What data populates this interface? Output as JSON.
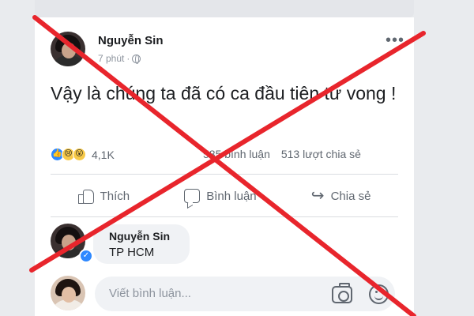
{
  "post": {
    "author": "Nguyễn Sin",
    "time": "7 phút",
    "separator": "·",
    "more": "•••",
    "text": "Vậy là chúng ta đã có ca đầu tiên tử vong !",
    "reaction_count": "4,1K",
    "comments_count": "585 bình luận",
    "shares_count": "513 lượt chia sẻ"
  },
  "actions": {
    "like": "Thích",
    "comment": "Bình luận",
    "share": "Chia sẻ"
  },
  "comment": {
    "author": "Nguyễn Sin",
    "text": "TP HCM"
  },
  "reply": {
    "placeholder": "Viết bình luận..."
  },
  "icons": {
    "globe": "globe-icon",
    "like": "like-icon",
    "comment": "comment-icon",
    "share": "share-icon",
    "camera": "camera-icon",
    "emoji": "smile-icon",
    "verified": "check-icon"
  },
  "colors": {
    "cross": "#e8252c",
    "accent": "#2d88ff",
    "bubble": "#f0f2f5"
  }
}
